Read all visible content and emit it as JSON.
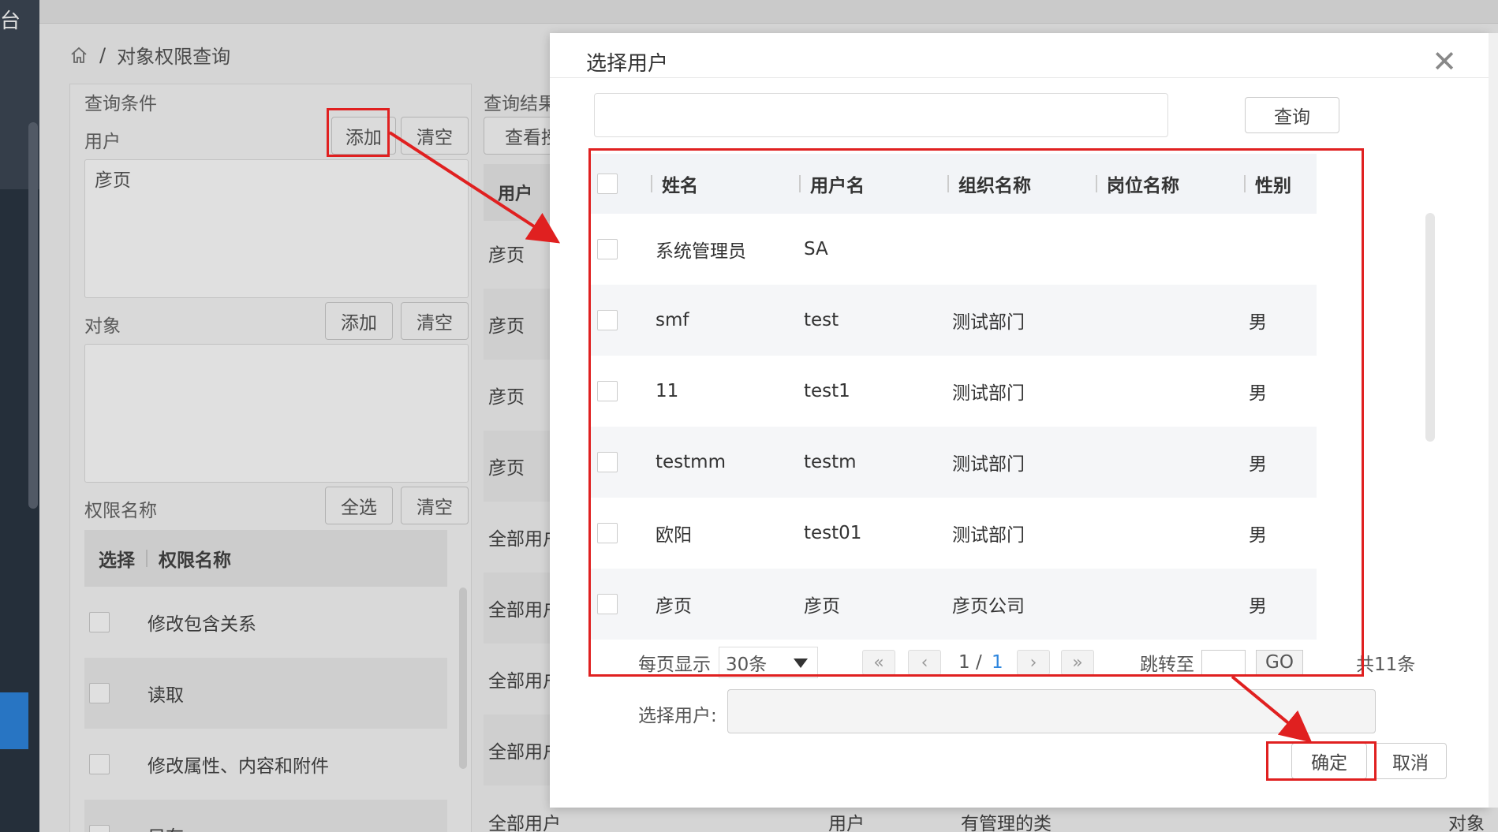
{
  "sidebar": {
    "title_char": "台"
  },
  "breadcrumb": {
    "separator": "/",
    "current": "对象权限查询"
  },
  "query": {
    "title": "查询条件",
    "user_label": "用户",
    "user_add": "添加",
    "user_clear": "清空",
    "user_value": "彦页",
    "object_label": "对象",
    "object_add": "添加",
    "object_clear": "清空",
    "perm_label": "权限名称",
    "perm_select_all": "全选",
    "perm_clear": "清空",
    "perm_header_select": "选择",
    "perm_header_name": "权限名称",
    "perm_items": [
      "修改包含关系",
      "读取",
      "修改属性、内容和附件",
      "只有"
    ]
  },
  "results": {
    "title": "查询结果",
    "view_btn": "查看授",
    "header": "用户",
    "rows": [
      "彦页",
      "彦页",
      "彦页",
      "彦页",
      "全部用户",
      "全部用户",
      "全部用户",
      "全部用户"
    ],
    "bottom": [
      "全部用户",
      "用户",
      "有管理的类",
      "对象分"
    ]
  },
  "modal": {
    "title": "选择用户",
    "close": "✕",
    "search_value": "",
    "query_btn": "查询",
    "columns": [
      "姓名",
      "用户名",
      "组织名称",
      "岗位名称",
      "性别"
    ],
    "rows": [
      {
        "name": "系统管理员",
        "username": "SA",
        "org": "",
        "post": "",
        "gender": ""
      },
      {
        "name": "smf",
        "username": "test",
        "org": "测试部门",
        "post": "",
        "gender": "男"
      },
      {
        "name": "11",
        "username": "test1",
        "org": "测试部门",
        "post": "",
        "gender": "男"
      },
      {
        "name": "testmm",
        "username": "testm",
        "org": "测试部门",
        "post": "",
        "gender": "男"
      },
      {
        "name": "欧阳",
        "username": "test01",
        "org": "测试部门",
        "post": "",
        "gender": "男"
      },
      {
        "name": "彦页",
        "username": "彦页",
        "org": "彦页公司",
        "post": "",
        "gender": "男"
      }
    ],
    "pager": {
      "per_page_label": "每页显示",
      "per_page_value": "30条",
      "first": "«",
      "prev": "‹",
      "current_page": "1",
      "page_sep": "/",
      "total_pages": "1",
      "next": "›",
      "last": "»",
      "jump_label": "跳转至",
      "go": "GO",
      "total": "共11条"
    },
    "selected_label": "选择用户:",
    "selected_value": "",
    "ok": "确定",
    "cancel": "取消"
  },
  "colors": {
    "annotation_red": "#e02020",
    "sidebar_dark": "#2b3643",
    "active_blue": "#2e86de"
  }
}
